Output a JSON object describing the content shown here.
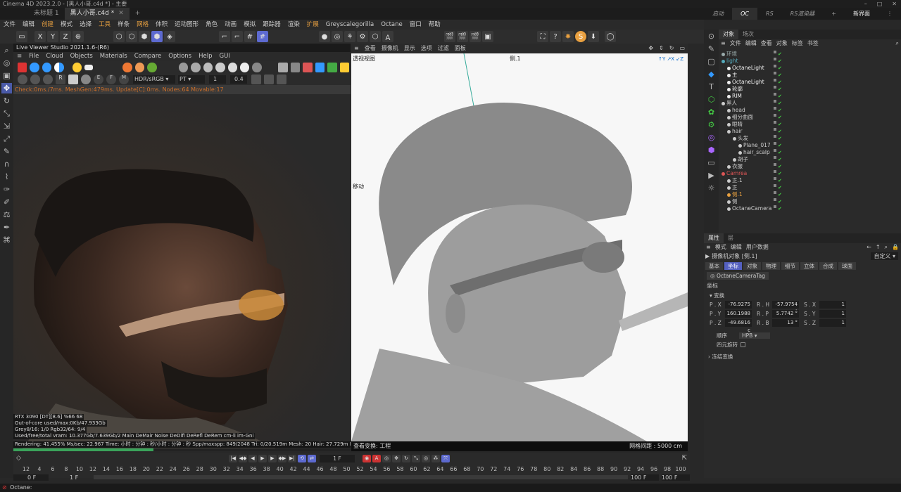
{
  "title": "Cinema 4D 2023.2.0 - [黑人小哥.c4d *] - 主要",
  "tabs": [
    {
      "label": "未标题 1",
      "active": false
    },
    {
      "label": "黑人小哥.c4d *",
      "active": true
    }
  ],
  "layout_tabs": [
    {
      "label": "启动",
      "active": false
    },
    {
      "label": "OC",
      "active": true
    },
    {
      "label": "RS",
      "active": false
    },
    {
      "label": "RS渲染器",
      "active": false
    }
  ],
  "layout_right": "新界面",
  "menu": [
    "文件",
    "编辑",
    "创建",
    "模式",
    "选择",
    "工具",
    "样条",
    "网格",
    "体积",
    "运动图形",
    "角色",
    "动画",
    "模拟",
    "跟踪器",
    "渲染",
    "扩展",
    "Greyscalegorilla",
    "Octane",
    "窗口",
    "帮助"
  ],
  "toolbar": {
    "x": "X",
    "y": "Y",
    "z": "Z"
  },
  "live_viewer": {
    "title": "Live Viewer Studio 2021.1.6-(R6)",
    "menu": [
      "File",
      "Cloud",
      "Objects",
      "Materials",
      "Compare",
      "Options",
      "Help",
      "GUI"
    ],
    "colorspace": "HDR/sRGB",
    "kernel": "PT",
    "field1": "1",
    "field2": "0.4",
    "status": "Check:0ms./7ms. MeshGen:479ms. Update[C]:0ms. Nodes:64 Movable:17",
    "stats": [
      "RTX 3090 [DT][8.6]     %66    68",
      "Out-of-core used/max:0Kb/47.933Gb",
      "Grey8/16: 1/0          Rgb32/64: 9/4",
      "Used/free/total vram: 10.377Gb/7.639Gb/2  Main DeMair Noise DeDifi DeRefl DeRem cm-li im-Gni"
    ],
    "bottom": "Rendering: 41.455%   Ms/sec: 22.967   Time: 小时 : 分钟 : 秒/小时 : 分钟 : 秒   Spp/maxspp: 849/2048   Tri: 0/20.519m   Mesh: 20   Hair: 27.729m   RTX:on",
    "progress": 0.41455
  },
  "viewport": {
    "menu": [
      "查看",
      "摄像机",
      "显示",
      "选项",
      "过滤",
      "面板"
    ],
    "view_label": "透视视图",
    "camera_label": "侧.1",
    "move_label": "移动",
    "bottom_left": "查看变换: 工程",
    "bottom_right": "网格间距 : 5000 cm"
  },
  "objects": {
    "tabs": [
      {
        "label": "对象",
        "active": true
      },
      {
        "label": "场次",
        "active": false
      }
    ],
    "menu": [
      "文件",
      "编辑",
      "查看",
      "对象",
      "标签",
      "书签"
    ],
    "rows": [
      {
        "name": "环境",
        "indent": 0,
        "color": "#9aa"
      },
      {
        "name": "light",
        "indent": 0,
        "color": "#5ab"
      },
      {
        "name": "OctaneLight",
        "indent": 1,
        "color": "#eee"
      },
      {
        "name": "主",
        "indent": 1,
        "color": "#eee"
      },
      {
        "name": "OctaneLight",
        "indent": 1,
        "color": "#eee"
      },
      {
        "name": "轮廓",
        "indent": 1,
        "color": "#eee"
      },
      {
        "name": "RIM",
        "indent": 1,
        "color": "#eee"
      },
      {
        "name": "黑人",
        "indent": 0,
        "color": "#ccc"
      },
      {
        "name": "head",
        "indent": 1,
        "color": "#ccc"
      },
      {
        "name": "细分曲面",
        "indent": 1,
        "color": "#ccc"
      },
      {
        "name": "眼睛",
        "indent": 1,
        "color": "#ccc"
      },
      {
        "name": "hair",
        "indent": 1,
        "color": "#ccc"
      },
      {
        "name": "头发",
        "indent": 2,
        "color": "#ccc"
      },
      {
        "name": "Plane_017",
        "indent": 3,
        "color": "#ccc"
      },
      {
        "name": "hair_scalp",
        "indent": 3,
        "color": "#ccc"
      },
      {
        "name": "胡子",
        "indent": 2,
        "color": "#ccc"
      },
      {
        "name": "衣服",
        "indent": 1,
        "color": "#ccc"
      },
      {
        "name": "Camrea",
        "indent": 0,
        "color": "#d55"
      },
      {
        "name": "正.1",
        "indent": 1,
        "color": "#ccc"
      },
      {
        "name": "正",
        "indent": 1,
        "color": "#ccc"
      },
      {
        "name": "侧.1",
        "indent": 1,
        "color": "#e8a040"
      },
      {
        "name": "侧",
        "indent": 1,
        "color": "#ccc"
      },
      {
        "name": "OctaneCamera",
        "indent": 1,
        "color": "#ccc"
      }
    ]
  },
  "attributes": {
    "tabs": [
      {
        "label": "属性",
        "active": true
      },
      {
        "label": "层",
        "active": false
      }
    ],
    "menu": [
      "模式",
      "编辑",
      "用户数据"
    ],
    "object_label": "摄像机对象 [侧.1]",
    "preset": "自定义",
    "subtabs": [
      {
        "label": "基本",
        "active": false
      },
      {
        "label": "坐标",
        "active": true
      },
      {
        "label": "对象",
        "active": false
      },
      {
        "label": "物理",
        "active": false
      },
      {
        "label": "细节",
        "active": false
      },
      {
        "label": "立体",
        "active": false
      },
      {
        "label": "合成",
        "active": false
      },
      {
        "label": "球面",
        "active": false
      }
    ],
    "tag": "OctaneCameraTag",
    "section": "坐标",
    "transform": "变换",
    "coords": [
      {
        "p": "P . X",
        "pv": "-76.9275 c",
        "r": "R . H",
        "rv": "-57.9754 °",
        "s": "S . X",
        "sv": "1"
      },
      {
        "p": "P . Y",
        "pv": "160.1988 c",
        "r": "R . P",
        "rv": "5.7742 °",
        "s": "S . Y",
        "sv": "1"
      },
      {
        "p": "P . Z",
        "pv": "-49.6816 c",
        "r": "R . B",
        "rv": "13 °",
        "s": "S . Z",
        "sv": "1"
      }
    ],
    "order_label": "顺序",
    "order_value": "HPB",
    "quat_label": "四元旋转",
    "freeze": "冻结变换"
  },
  "timeline": {
    "current_frame": "1 F",
    "ticks": [
      "12",
      "4",
      "6",
      "8",
      "10",
      "12",
      "14",
      "16",
      "18",
      "20",
      "22",
      "24",
      "26",
      "28",
      "30",
      "32",
      "34",
      "36",
      "38",
      "40",
      "42",
      "44",
      "46",
      "48",
      "50",
      "52",
      "54",
      "56",
      "58",
      "60",
      "62",
      "64",
      "66",
      "68",
      "70",
      "72",
      "74",
      "76",
      "78",
      "80",
      "82",
      "84",
      "86",
      "88",
      "90",
      "92",
      "94",
      "96",
      "98",
      "100"
    ],
    "start": "0 F",
    "start2": "1 F",
    "end": "100 F",
    "end2": "100 F"
  },
  "status": "Octane:",
  "colors": {
    "accent": "#5460c0",
    "orange": "#e8a040"
  }
}
